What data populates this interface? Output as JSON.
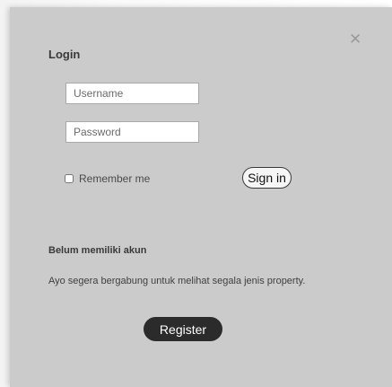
{
  "login": {
    "title": "Login",
    "close_icon": "close-icon",
    "username_placeholder": "Username",
    "username_value": "",
    "password_placeholder": "Password",
    "password_value": "",
    "remember_label": "Remember me",
    "remember_checked": false,
    "signin_label": "Sign in"
  },
  "register": {
    "heading": "Belum memiliki akun",
    "description": "Ayo segera bergabung untuk melihat segala jenis property.",
    "button_label": "Register"
  }
}
